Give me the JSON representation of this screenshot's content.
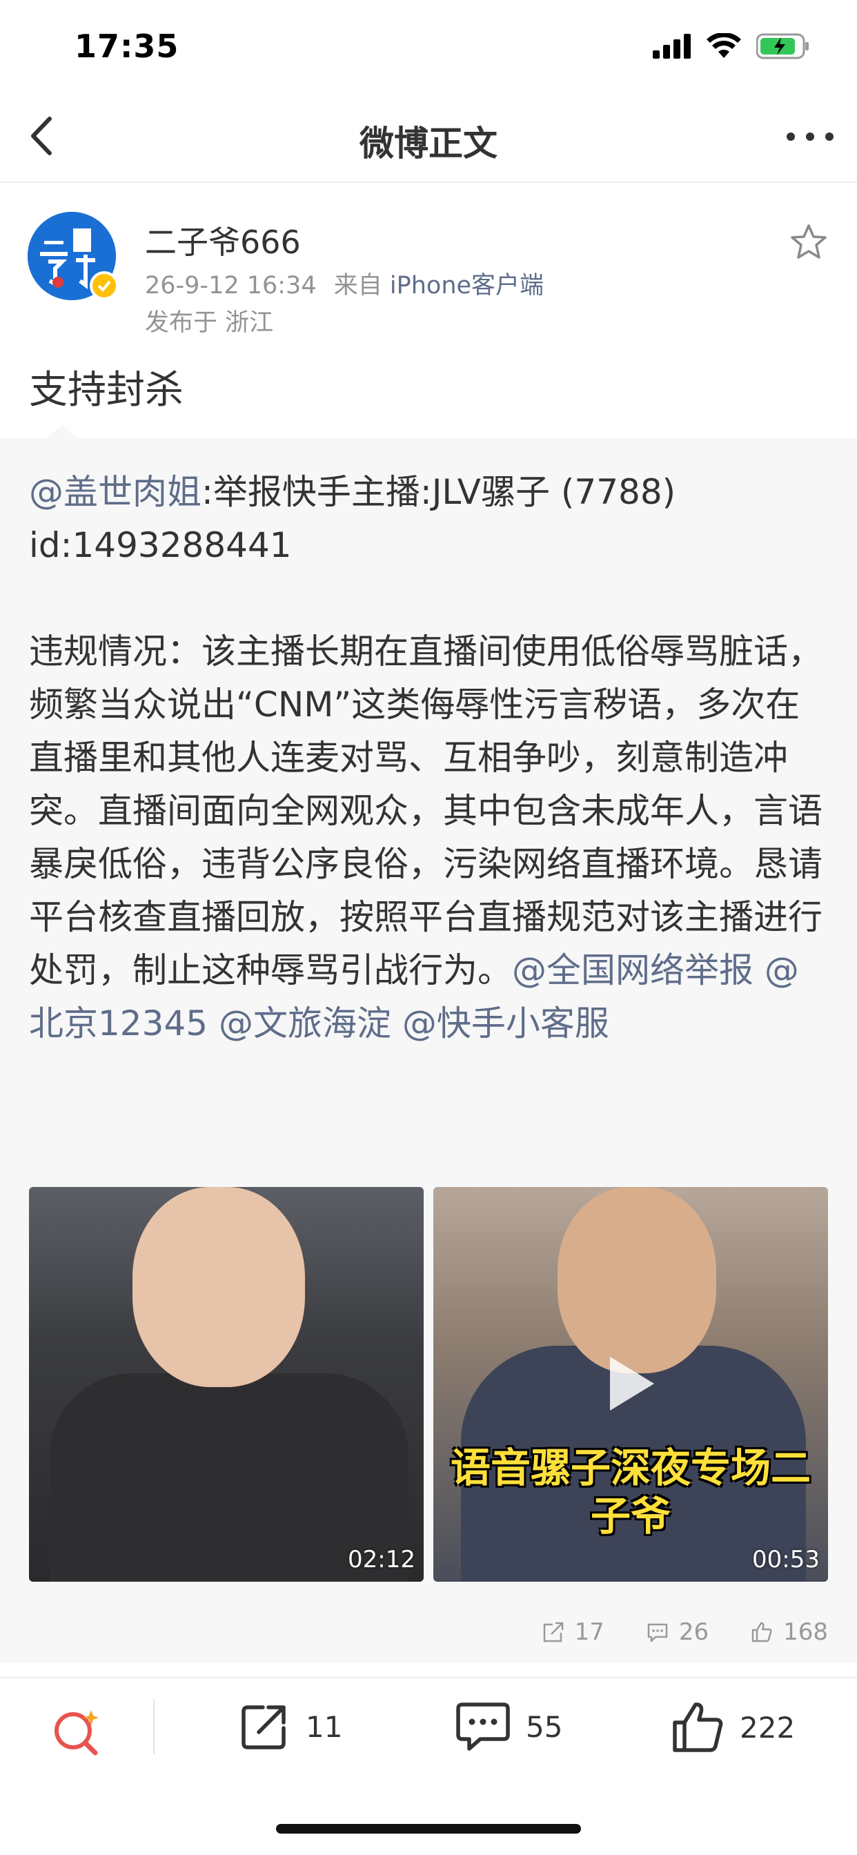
{
  "status_bar": {
    "time": "17:35"
  },
  "nav": {
    "title": "微博正文"
  },
  "post": {
    "username": "二子爷666",
    "timestamp": "26-9-12 16:34",
    "source_prefix": "来自",
    "source": "iPhone客户端",
    "location": "发布于 浙江",
    "text": "支持封杀"
  },
  "repost": {
    "mention": "@盖世肉姐",
    "line1": ":举报快手主播:JLV骡子 (7788)",
    "line2": "id:1493288441",
    "body": "违规情况：该主播长期在直播间使用低俗辱骂脏话，频繁当众说出“CNM”这类侮辱性污言秽语，多次在直播里和其他人连麦对骂、互相争吵，刻意制造冲突。直播间面向全网观众，其中包含未成年人，言语暴戾低俗，违背公序良俗，污染网络直播环境。恳请平台核查直播回放，按照平台直播规范对该主播进行处罚，制止这种辱骂引战行为。",
    "tags": [
      "@全国网络举报",
      "@北京12345",
      "@文旅海淀",
      "@快手小客服"
    ],
    "media": [
      {
        "duration": "02:12"
      },
      {
        "duration": "00:53",
        "caption": "语音骡子深夜专场二子爷"
      }
    ],
    "actions": {
      "reposts": "17",
      "comments": "26",
      "likes": "168"
    }
  },
  "toolbar": {
    "reposts": "11",
    "comments": "55",
    "likes": "222"
  },
  "colors": {
    "link": "#5f6d8a",
    "accent": "#e8534f",
    "verified": "#ffc107"
  }
}
